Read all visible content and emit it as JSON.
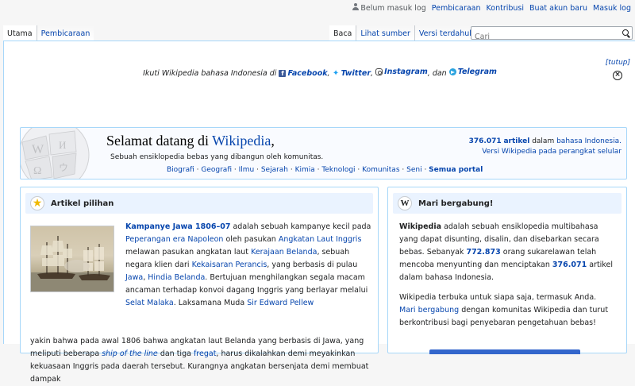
{
  "personal": {
    "not_logged_in": "Belum masuk log",
    "talk": "Pembicaraan",
    "contributions": "Kontribusi",
    "create_account": "Buat akun baru",
    "login": "Masuk log"
  },
  "tabs": {
    "left": [
      "Utama",
      "Pembicaraan"
    ],
    "right": [
      "Baca",
      "Lihat sumber",
      "Versi terdahulu"
    ]
  },
  "search": {
    "placeholder": "Cari"
  },
  "notice": {
    "prefix": "Ikuti Wikipedia bahasa Indonesia di",
    "facebook": "Facebook",
    "twitter": "Twitter",
    "instagram": "Instagram",
    "and": "dan",
    "telegram": "Telegram",
    "dismiss": "[tutup]"
  },
  "welcome": {
    "title_prefix": "Selamat datang di",
    "title_link": "Wikipedia",
    "title_suffix": ",",
    "subtitle": "Sebuah ensiklopedia bebas yang dibangun oleh komunitas.",
    "portals": [
      "Biografi",
      "Geografi",
      "Ilmu",
      "Sejarah",
      "Kimia",
      "Teknologi",
      "Komunitas",
      "Seni"
    ],
    "all_portals": "Semua portal",
    "articles_count": "376.071",
    "articles_label": "artikel",
    "in_label": "dalam",
    "language": "bahasa Indonesia.",
    "mobile_link": "Versi Wikipedia pada perangkat selular"
  },
  "featured": {
    "heading": "Artikel pilihan",
    "title": "Kampanye Jawa 1806–07",
    "t1": "adalah sebuah kampanye kecil pada",
    "l1": "Peperangan era Napoleon",
    "t2": "oleh pasukan",
    "l2": "Angkatan Laut Inggris",
    "t3": "melawan pasukan angkatan laut",
    "l3": "Kerajaan Belanda",
    "t4": ", sebuah negara klien dari",
    "l4": "Kekaisaran Perancis",
    "t5": ", yang berbasis di pulau",
    "l5": "Jawa",
    "t6": ",",
    "l6": "Hindia Belanda",
    "t7": ". Bertujuan menghilangkan segala macam ancaman terhadap konvoi dagang Inggris yang berlayar melalui",
    "l7": "Selat Malaka",
    "t8": ". Laksamana Muda",
    "l8": "Sir Edward Pellew",
    "t9": "yakin bahwa pada awal 1806 bahwa angkatan laut Belanda yang berbasis di Jawa, yang meliputi beberapa",
    "l9": "ship of the line",
    "t10": "dan tiga",
    "l10": "fregat",
    "t11": ", harus dikalahkan demi meyakinkan kekuasaan Inggris pada daerah tersebut. Kurangnya angkatan bersenjata demi membuat dampak"
  },
  "join": {
    "heading": "Mari bergabung!",
    "p1_bold": "Wikipedia",
    "p1_a": "adalah sebuah ensiklopedia multibahasa yang dapat disunting, disalin, dan disebarkan secara bebas. Sebanyak",
    "p1_users": "772.873",
    "p1_b": "orang sukarelawan telah mencoba menyunting dan menciptakan",
    "p1_articles": "376.071",
    "p1_c": "artikel dalam bahasa Indonesia.",
    "p2": "Wikipedia terbuka untuk siapa saja, termasuk Anda.",
    "p3_link": "Mari bergabung",
    "p3_text": "dengan komunitas Wikipedia dan turut berkontribusi bagi penyebaran pengetahuan bebas!"
  }
}
